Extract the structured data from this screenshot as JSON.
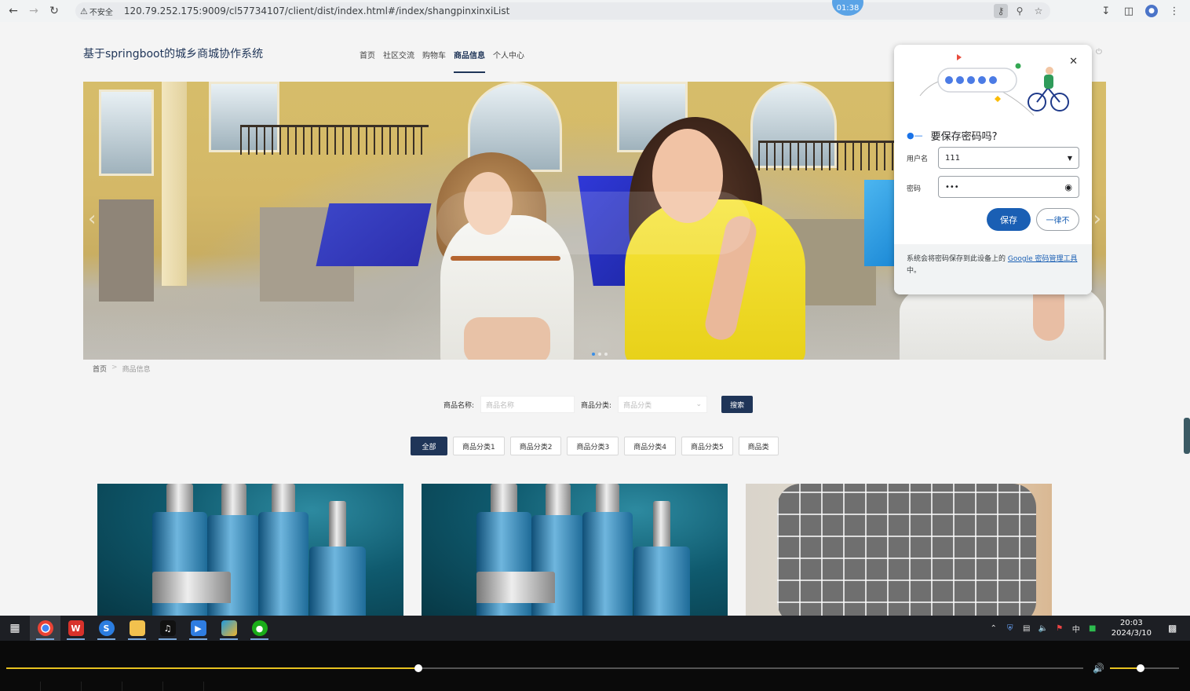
{
  "browser": {
    "security_label": "不安全",
    "url": "120.79.252.175:9009/cl57734107/client/dist/index.html#/index/shangpinxinxiList",
    "timer_badge": "01:38"
  },
  "site": {
    "title": "基于springboot的城乡商城协作系统",
    "nav": [
      {
        "label": "首页",
        "active": false
      },
      {
        "label": "社区交流",
        "active": false
      },
      {
        "label": "购物车",
        "active": false
      },
      {
        "label": "商品信息",
        "active": true
      },
      {
        "label": "个人中心",
        "active": false
      }
    ]
  },
  "breadcrumb": {
    "home": "首页",
    "separator": ">",
    "current": "商品信息"
  },
  "search": {
    "name_label": "商品名称:",
    "name_placeholder": "商品名称",
    "category_label": "商品分类:",
    "category_placeholder": "商品分类",
    "button": "搜索"
  },
  "categories": [
    {
      "label": "全部",
      "active": true
    },
    {
      "label": "商品分类1",
      "active": false
    },
    {
      "label": "商品分类2",
      "active": false
    },
    {
      "label": "商品分类3",
      "active": false
    },
    {
      "label": "商品分类4",
      "active": false
    },
    {
      "label": "商品分类5",
      "active": false
    },
    {
      "label": "商品类",
      "active": false
    }
  ],
  "password_dialog": {
    "title": "要保存密码吗?",
    "username_label": "用户名",
    "username_value": "111",
    "password_label": "密码",
    "password_value": "•••",
    "save_button": "保存",
    "never_button": "一律不",
    "footer_text": "系统会将密码保存到此设备上的",
    "footer_link": "Google 密码管理工具",
    "footer_suffix": "中。"
  },
  "taskbar": {
    "clock_time": "20:03",
    "clock_date": "2024/3/10",
    "ime": "中",
    "apps": [
      "chrome-icon",
      "wps-icon",
      "sogou-icon",
      "file-explorer-icon",
      "tiktok-icon",
      "video-player-icon",
      "store-icon",
      "wechat-icon"
    ]
  },
  "player": {
    "progress": 0.383,
    "volume": 0.44,
    "accent": "#e6c21f"
  },
  "colors": {
    "brand_dark": "#1f3558",
    "chrome_blue": "#1a5fb4"
  }
}
